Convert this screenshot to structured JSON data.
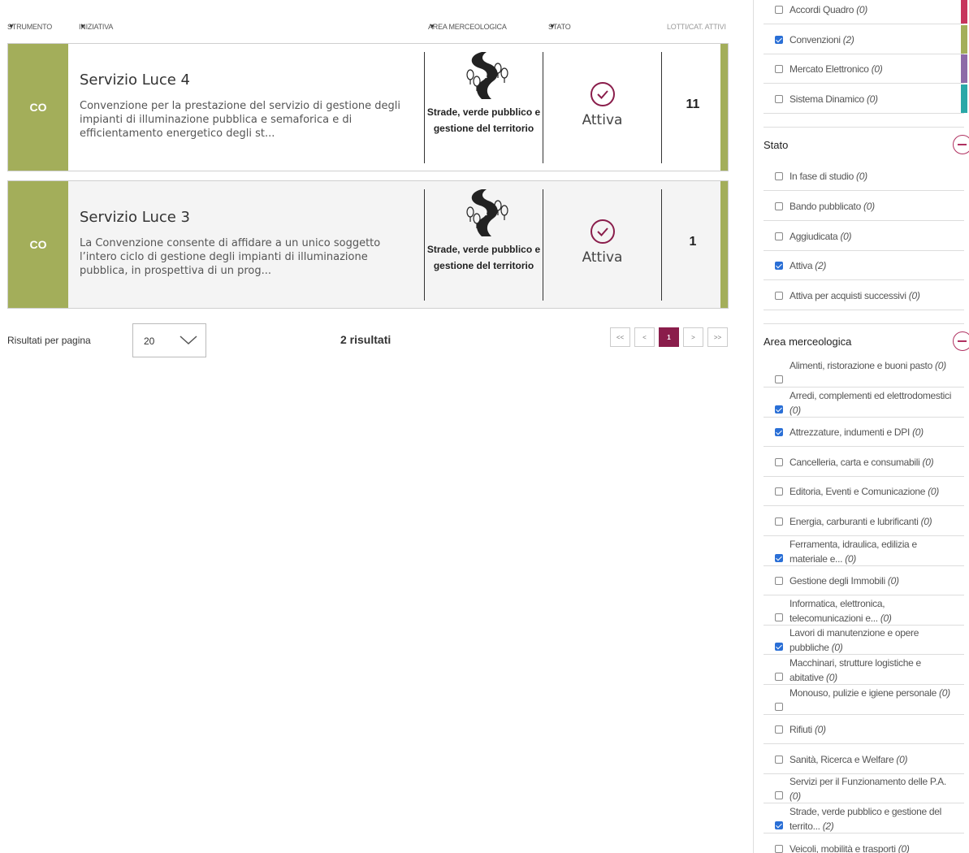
{
  "columns": {
    "strumento": "STRUMENTO",
    "iniziativa": "INIZIATIVA",
    "area": "AREA MERCEOLOGICA",
    "stato": "STATO",
    "lotti": "LOTTI/CAT. ATTIVI"
  },
  "results": [
    {
      "badge": "CO",
      "title": "Servizio Luce 4",
      "description": "Convenzione per la prestazione del servizio di gestione degli impianti di illuminazione pubblica e semaforica e di efficientamento energetico degli st...",
      "area": "Strade, verde pubblico e gestione del territorio",
      "stato": "Attiva",
      "lotti": "11"
    },
    {
      "badge": "CO",
      "title": "Servizio Luce 3",
      "description": "La Convenzione consente di affidare a un unico soggetto l’intero ciclo di gestione degli impianti di illuminazione pubblica, in prospettiva di un prog...",
      "area": "Strade, verde pubblico e gestione del territorio",
      "stato": "Attiva",
      "lotti": "1"
    }
  ],
  "pagination": {
    "per_page_label": "Risultati per pagina",
    "per_page_value": "20",
    "results_count": "2 risultati",
    "first": "<<",
    "prev": "<",
    "current": "1",
    "next": ">",
    "last": ">>"
  },
  "filters": {
    "strumento": [
      {
        "label": "Accordi Quadro",
        "count": "(0)",
        "checked": false,
        "color": "#c7335c"
      },
      {
        "label": "Convenzioni",
        "count": "(2)",
        "checked": true,
        "color": "#a3ae5a"
      },
      {
        "label": "Mercato Elettronico",
        "count": "(0)",
        "checked": false,
        "color": "#8e6aa8"
      },
      {
        "label": "Sistema Dinamico",
        "count": "(0)",
        "checked": false,
        "color": "#2aa8a8"
      }
    ],
    "stato_title": "Stato",
    "stato": [
      {
        "label": "In fase di studio",
        "count": "(0)",
        "checked": false
      },
      {
        "label": "Bando pubblicato",
        "count": "(0)",
        "checked": false
      },
      {
        "label": "Aggiudicata",
        "count": "(0)",
        "checked": false
      },
      {
        "label": "Attiva",
        "count": "(2)",
        "checked": true
      },
      {
        "label": "Attiva per acquisti successivi",
        "count": "(0)",
        "checked": false
      }
    ],
    "area_title": "Area merceologica",
    "area": [
      {
        "label": "Alimenti, ristorazione e buoni pasto",
        "count": "(0)",
        "checked": false
      },
      {
        "label": "Arredi, complementi ed elettrodomestici",
        "count": "(0)",
        "checked": true
      },
      {
        "label": "Attrezzature, indumenti e DPI",
        "count": "(0)",
        "checked": true
      },
      {
        "label": "Cancelleria, carta e consumabili",
        "count": "(0)",
        "checked": false
      },
      {
        "label": "Editoria, Eventi e Comunicazione",
        "count": "(0)",
        "checked": false
      },
      {
        "label": "Energia, carburanti e lubrificanti",
        "count": "(0)",
        "checked": false
      },
      {
        "label": "Ferramenta, idraulica, edilizia e materiale e...",
        "count": "(0)",
        "checked": true
      },
      {
        "label": "Gestione degli Immobili",
        "count": "(0)",
        "checked": false
      },
      {
        "label": "Informatica, elettronica, telecomunicazioni e...",
        "count": "(0)",
        "checked": false
      },
      {
        "label": "Lavori di manutenzione e opere pubbliche",
        "count": "(0)",
        "checked": true
      },
      {
        "label": "Macchinari, strutture logistiche e abitative",
        "count": "(0)",
        "checked": false
      },
      {
        "label": "Monouso, pulizie e igiene personale",
        "count": "(0)",
        "checked": false
      },
      {
        "label": "Rifiuti",
        "count": "(0)",
        "checked": false
      },
      {
        "label": "Sanità, Ricerca e Welfare",
        "count": "(0)",
        "checked": false
      },
      {
        "label": "Servizi per il Funzionamento delle P.A.",
        "count": "(0)",
        "checked": false
      },
      {
        "label": "Strade, verde pubblico e gestione del territo...",
        "count": "(2)",
        "checked": true
      },
      {
        "label": "Veicoli, mobilità e trasporti",
        "count": "(0)",
        "checked": false
      }
    ]
  }
}
